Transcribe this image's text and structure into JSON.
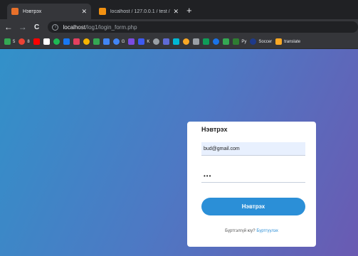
{
  "browser": {
    "tabs": [
      {
        "title": "Нэвтрэх",
        "favicon_color": "#e8702a",
        "active": true
      },
      {
        "title": "localhost / 127.0.0.1 / test / data",
        "favicon_color": "#f29111",
        "active": false
      }
    ],
    "new_tab_symbol": "+",
    "close_symbol": "✕",
    "nav": {
      "back": "←",
      "forward": "→",
      "reload": "C"
    },
    "url_host": "localhost",
    "url_path": "/log1/login_form.php",
    "info_symbol": "i"
  },
  "bookmarks": [
    {
      "label": "5",
      "color": "#34a853"
    },
    {
      "label": "8",
      "color": "#ea4335"
    },
    {
      "label": "",
      "color": "#ff0000"
    },
    {
      "label": "",
      "color": "#ffffff"
    },
    {
      "label": "",
      "color": "#1db954"
    },
    {
      "label": "",
      "color": "#1877f2"
    },
    {
      "label": "",
      "color": "#e4405f"
    },
    {
      "label": "",
      "color": "#f4b400"
    },
    {
      "label": "",
      "color": "#34a853"
    },
    {
      "label": "",
      "color": "#4285f4"
    },
    {
      "label": "G",
      "color": "#4285f4"
    },
    {
      "label": "",
      "color": "#7b4ce0"
    },
    {
      "label": "K",
      "color": "#3d5af1"
    },
    {
      "label": "",
      "color": "#9aa0a6"
    },
    {
      "label": "",
      "color": "#5f6bd6"
    },
    {
      "label": "",
      "color": "#00b8d4"
    },
    {
      "label": "",
      "color": "#f9a825"
    },
    {
      "label": "",
      "color": "#9aa0a6"
    },
    {
      "label": "",
      "color": "#0f9d58"
    },
    {
      "label": "",
      "color": "#1a73e8"
    },
    {
      "label": "",
      "color": "#34a853"
    },
    {
      "label": "Py",
      "color": "#2e7d32"
    },
    {
      "label": "Soccer",
      "color": "#1e3a8a"
    },
    {
      "label": "translate",
      "color": "#f9a825"
    }
  ],
  "login": {
    "title": "Нэвтрэх",
    "email_value": "bud@gmail.com",
    "password_mask": "•••",
    "submit_label": "Нэвтрэх",
    "signup_prompt": "Бүртгэлгүй юу?",
    "signup_link": "Бүртгүүлэх"
  }
}
